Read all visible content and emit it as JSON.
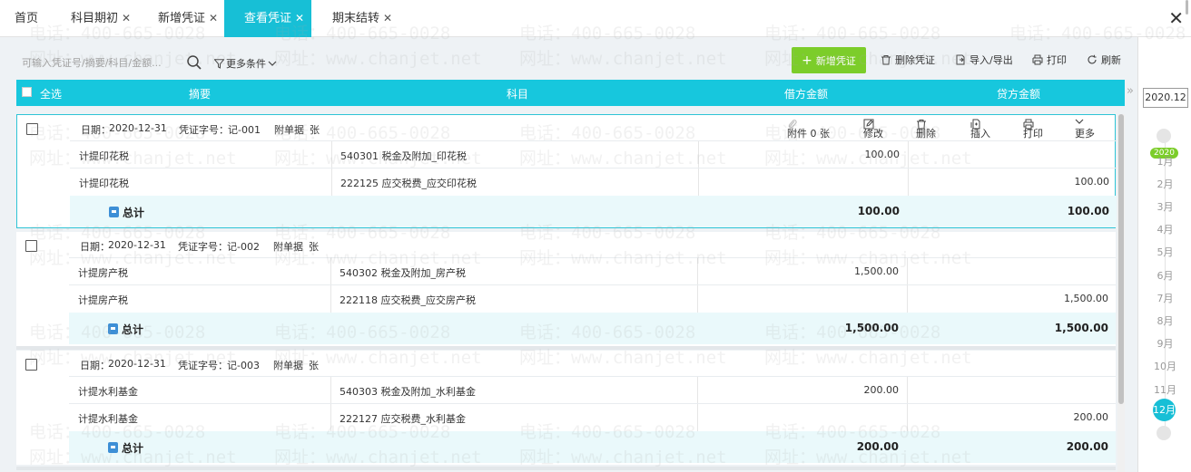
{
  "tabs": [
    {
      "label": "首页",
      "closable": false
    },
    {
      "label": "科目期初",
      "closable": true
    },
    {
      "label": "新增凭证",
      "closable": true
    },
    {
      "label": "查看凭证",
      "closable": true,
      "active": true
    },
    {
      "label": "期末结转",
      "closable": true
    }
  ],
  "window": {
    "close_glyph": "✕"
  },
  "toolbar": {
    "search_placeholder": "可输入凭证号/摘要/科目/金额...",
    "more_conditions": "更多条件",
    "new_voucher": "新增凭证",
    "delete_voucher": "删除凭证",
    "import_export": "导入/导出",
    "print": "打印",
    "refresh": "刷新"
  },
  "table_header": {
    "select_all": "全选",
    "summary": "摘要",
    "account": "科目",
    "debit": "借方金额",
    "credit": "贷方金额"
  },
  "voucher_actions": {
    "attachment": "附件 0 张",
    "edit": "修改",
    "delete": "删除",
    "insert": "插入",
    "print": "打印",
    "more": "更多"
  },
  "vouchers": [
    {
      "date_label": "日期：",
      "date": "2020-12-31",
      "no_label": "凭证字号：",
      "no": "记-001",
      "attach_label": "附单据",
      "attach_unit": "张",
      "entries": [
        {
          "summary": "计提印花税",
          "account": "540301 税金及附加_印花税",
          "debit": "100.00",
          "credit": ""
        },
        {
          "summary": "计提印花税",
          "account": "222125 应交税费_应交印花税",
          "debit": "",
          "credit": "100.00"
        }
      ],
      "total_label": "总计",
      "total_debit": "100.00",
      "total_credit": "100.00"
    },
    {
      "date_label": "日期：",
      "date": "2020-12-31",
      "no_label": "凭证字号：",
      "no": "记-002",
      "attach_label": "附单据",
      "attach_unit": "张",
      "entries": [
        {
          "summary": "计提房产税",
          "account": "540302 税金及附加_房产税",
          "debit": "1,500.00",
          "credit": ""
        },
        {
          "summary": "计提房产税",
          "account": "222118 应交税费_应交房产税",
          "debit": "",
          "credit": "1,500.00"
        }
      ],
      "total_label": "总计",
      "total_debit": "1,500.00",
      "total_credit": "1,500.00"
    },
    {
      "date_label": "日期：",
      "date": "2020-12-31",
      "no_label": "凭证字号：",
      "no": "记-003",
      "attach_label": "附单据",
      "attach_unit": "张",
      "entries": [
        {
          "summary": "计提水利基金",
          "account": "540303 税金及附加_水利基金",
          "debit": "200.00",
          "credit": ""
        },
        {
          "summary": "计提水利基金",
          "account": "222127 应交税费_水利基金",
          "debit": "",
          "credit": "200.00"
        }
      ],
      "total_label": "总计",
      "total_debit": "200.00",
      "total_credit": "200.00"
    }
  ],
  "right_panel": {
    "period": "2020.12",
    "collapse_glyph": "»",
    "year": "2020",
    "months": [
      "1月",
      "2月",
      "3月",
      "4月",
      "5月",
      "6月",
      "7月",
      "8月",
      "9月",
      "10月",
      "11月",
      "12月"
    ],
    "current_month": "12月"
  },
  "watermark": {
    "phone": "电话：400-665-0028",
    "site": "网址：www.chanjet.net"
  },
  "colors": {
    "accent": "#17bfd6",
    "green": "#7ccd2a"
  }
}
